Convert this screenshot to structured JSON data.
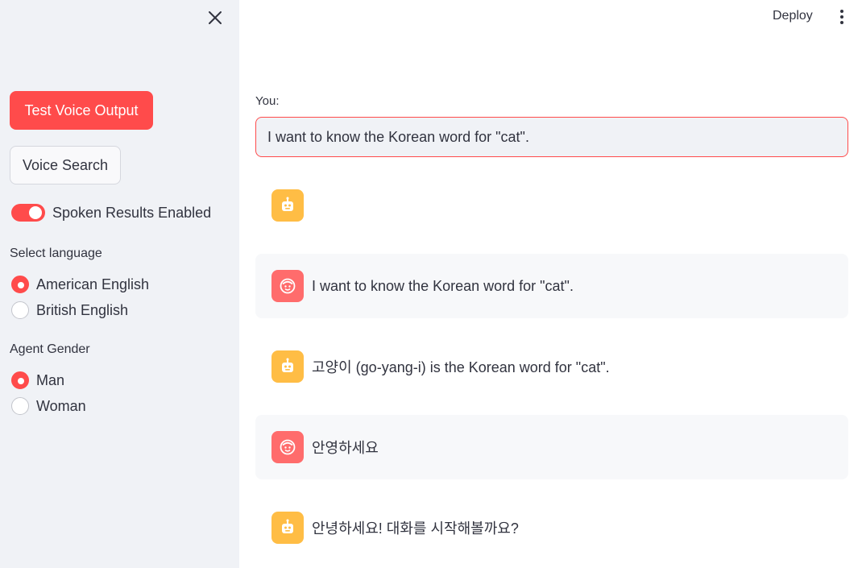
{
  "sidebar": {
    "test_voice_label": "Test Voice Output",
    "voice_search_label": "Voice Search",
    "toggle": {
      "label": "Spoken Results Enabled",
      "enabled": true
    },
    "language": {
      "label": "Select language",
      "options": [
        "American English",
        "British English"
      ],
      "selected": "American English"
    },
    "gender": {
      "label": "Agent Gender",
      "options": [
        "Man",
        "Woman"
      ],
      "selected": "Man"
    }
  },
  "header": {
    "deploy_label": "Deploy"
  },
  "main": {
    "you_label": "You:",
    "input_value": "I want to know the Korean word for \"cat\".",
    "messages": [
      {
        "role": "assistant",
        "text": ""
      },
      {
        "role": "user",
        "text": "I want to know the Korean word for \"cat\"."
      },
      {
        "role": "assistant",
        "text": "고양이 (go-yang-i) is the Korean word for \"cat\"."
      },
      {
        "role": "user",
        "text": "안영하세요"
      },
      {
        "role": "assistant",
        "text": "안녕하세요! 대화를 시작해볼까요?"
      }
    ]
  },
  "colors": {
    "accent": "#ff4b4b",
    "sidebar_bg": "#f0f2f6",
    "bot_avatar": "#ffbd45",
    "user_avatar": "#ff6c6c"
  }
}
